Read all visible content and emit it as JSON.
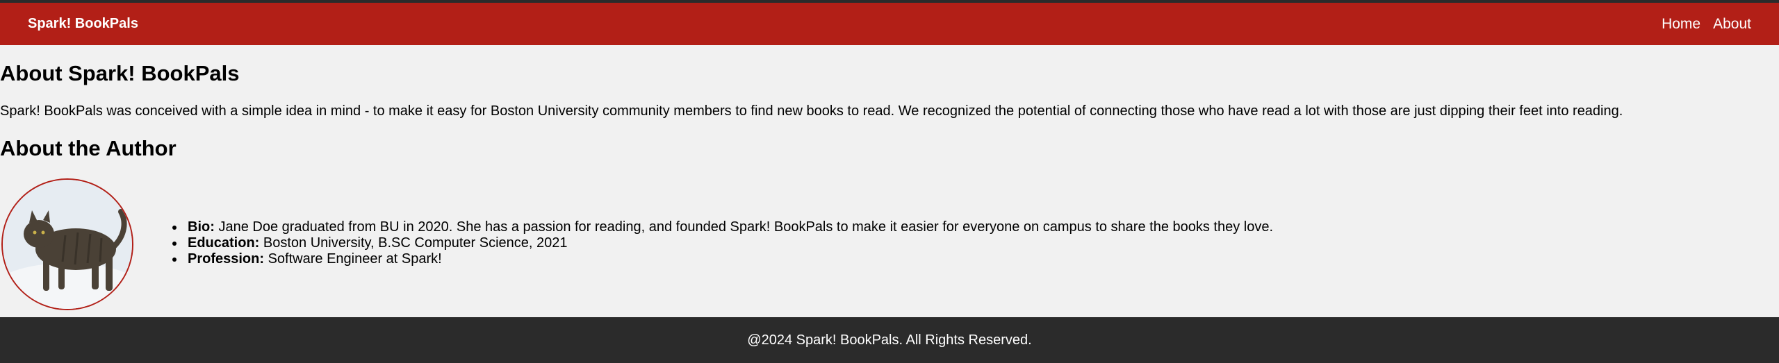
{
  "nav": {
    "brand": "Spark! BookPals",
    "links": [
      "Home",
      "About"
    ]
  },
  "about": {
    "title": "About Spark! BookPals",
    "text": "Spark! BookPals was conceived with a simple idea in mind - to make it easy for Boston University community members to find new books to read. We recognized the potential of connecting those who have read a lot with those are just dipping their feet into reading."
  },
  "author": {
    "title": "About the Author",
    "items": [
      {
        "label": "Bio:",
        "value": " Jane Doe graduated from BU in 2020. She has a passion for reading, and founded Spark! BookPals to make it easier for everyone on campus to share the books they love."
      },
      {
        "label": "Education:",
        "value": " Boston University, B.SC Computer Science, 2021"
      },
      {
        "label": "Profession:",
        "value": " Software Engineer at Spark!"
      }
    ]
  },
  "footer": {
    "text": "@2024 Spark! BookPals. All Rights Reserved."
  },
  "colors": {
    "navbar": "#b21f17",
    "footer": "#2b2b2b",
    "background": "#f1f1f1"
  }
}
